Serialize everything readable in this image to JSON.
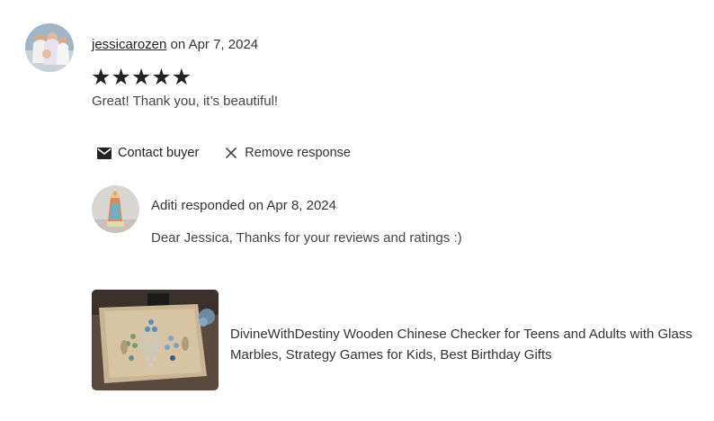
{
  "review": {
    "reviewer": "jessicarozen",
    "date_text": "on Apr 7, 2024",
    "stars": "★★★★★",
    "rating": 5,
    "text": "Great! Thank you, it’s beautiful!"
  },
  "actions": {
    "contact_label": "Contact buyer",
    "remove_label": "Remove response"
  },
  "response": {
    "heading": "Aditi responded on Apr 8, 2024",
    "text": "Dear Jessica, Thanks for your reviews and ratings :)"
  },
  "product": {
    "title": "DivineWithDestiny Wooden Chinese Checker for Teens and Adults with Glass Marbles, Strategy Games for Kids, Best Birthday Gifts"
  },
  "icons": {
    "contact": "envelope-icon",
    "remove": "close-icon"
  }
}
